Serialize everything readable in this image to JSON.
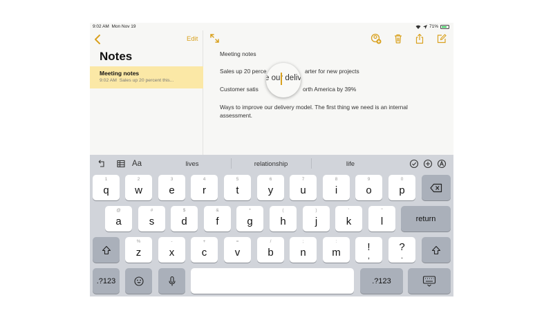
{
  "status_bar": {
    "time": "9:02 AM",
    "date": "Mon Nov 19",
    "battery": "71%"
  },
  "sidebar": {
    "edit_label": "Edit",
    "title": "Notes",
    "selected_note": {
      "title": "Meeting notes",
      "time": "9:02 AM",
      "preview": "Sales up 20 percent this..."
    }
  },
  "note": {
    "lines": [
      "Meeting notes",
      "Sales up 20 perce",
      "arter for new projects",
      "Customer satis",
      "orth America by 39%",
      "Ways to improve our delivery model. The first thing we need is an internal",
      "assessment."
    ],
    "magnifier_text": "e our deliver"
  },
  "keyboard": {
    "format_label": "Aa",
    "suggestions": [
      "lives",
      "relationship",
      "life"
    ],
    "row1": [
      {
        "k": "q",
        "h": "1"
      },
      {
        "k": "w",
        "h": "2"
      },
      {
        "k": "e",
        "h": "3"
      },
      {
        "k": "r",
        "h": "4"
      },
      {
        "k": "t",
        "h": "5"
      },
      {
        "k": "y",
        "h": "6"
      },
      {
        "k": "u",
        "h": "7"
      },
      {
        "k": "i",
        "h": "8"
      },
      {
        "k": "o",
        "h": "9"
      },
      {
        "k": "p",
        "h": "0"
      }
    ],
    "row2": [
      {
        "k": "a",
        "h": "@"
      },
      {
        "k": "s",
        "h": "#"
      },
      {
        "k": "d",
        "h": "$"
      },
      {
        "k": "f",
        "h": "&"
      },
      {
        "k": "g",
        "h": "*"
      },
      {
        "k": "h",
        "h": "("
      },
      {
        "k": "j",
        "h": ")"
      },
      {
        "k": "k",
        "h": "'"
      },
      {
        "k": "l",
        "h": "\""
      }
    ],
    "return_label": "return",
    "row3": [
      {
        "k": "z",
        "h": "%"
      },
      {
        "k": "x",
        "h": "-"
      },
      {
        "k": "c",
        "h": "+"
      },
      {
        "k": "v",
        "h": "="
      },
      {
        "k": "b",
        "h": "/"
      },
      {
        "k": "n",
        "h": ";"
      },
      {
        "k": "m",
        "h": ":"
      },
      {
        "k": "!",
        "h": ""
      },
      {
        "k": "?",
        "h": ""
      }
    ],
    "row3_sub": [
      ",",
      "."
    ],
    "numbers_label": ".?123"
  },
  "colors": {
    "accent": "#d9a11e",
    "selected_row": "#fbe8a6",
    "keyboard_bg": "#d1d4da"
  }
}
